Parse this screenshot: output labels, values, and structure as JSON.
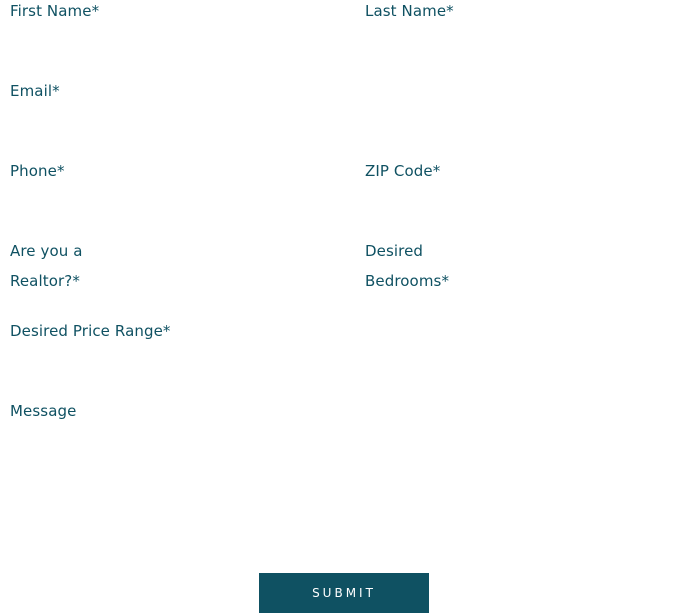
{
  "form": {
    "first_name": {
      "label": "First Name*",
      "value": ""
    },
    "last_name": {
      "label": "Last Name*",
      "value": ""
    },
    "email": {
      "label": "Email*",
      "value": ""
    },
    "phone": {
      "label": "Phone*",
      "value": ""
    },
    "zip": {
      "label": "ZIP Code*",
      "value": ""
    },
    "realtor": {
      "label": "Are you a Realtor?*",
      "value": ""
    },
    "bedrooms": {
      "label": "Desired Bedrooms*",
      "value": ""
    },
    "price_range": {
      "label": "Desired Price Range*",
      "value": ""
    },
    "message": {
      "label": "Message",
      "value": ""
    },
    "submit_label": "SUBMIT"
  },
  "colors": {
    "text": "#0f5162",
    "button_bg": "#0f5162",
    "button_text": "#ffffff",
    "background": "#ffffff"
  }
}
